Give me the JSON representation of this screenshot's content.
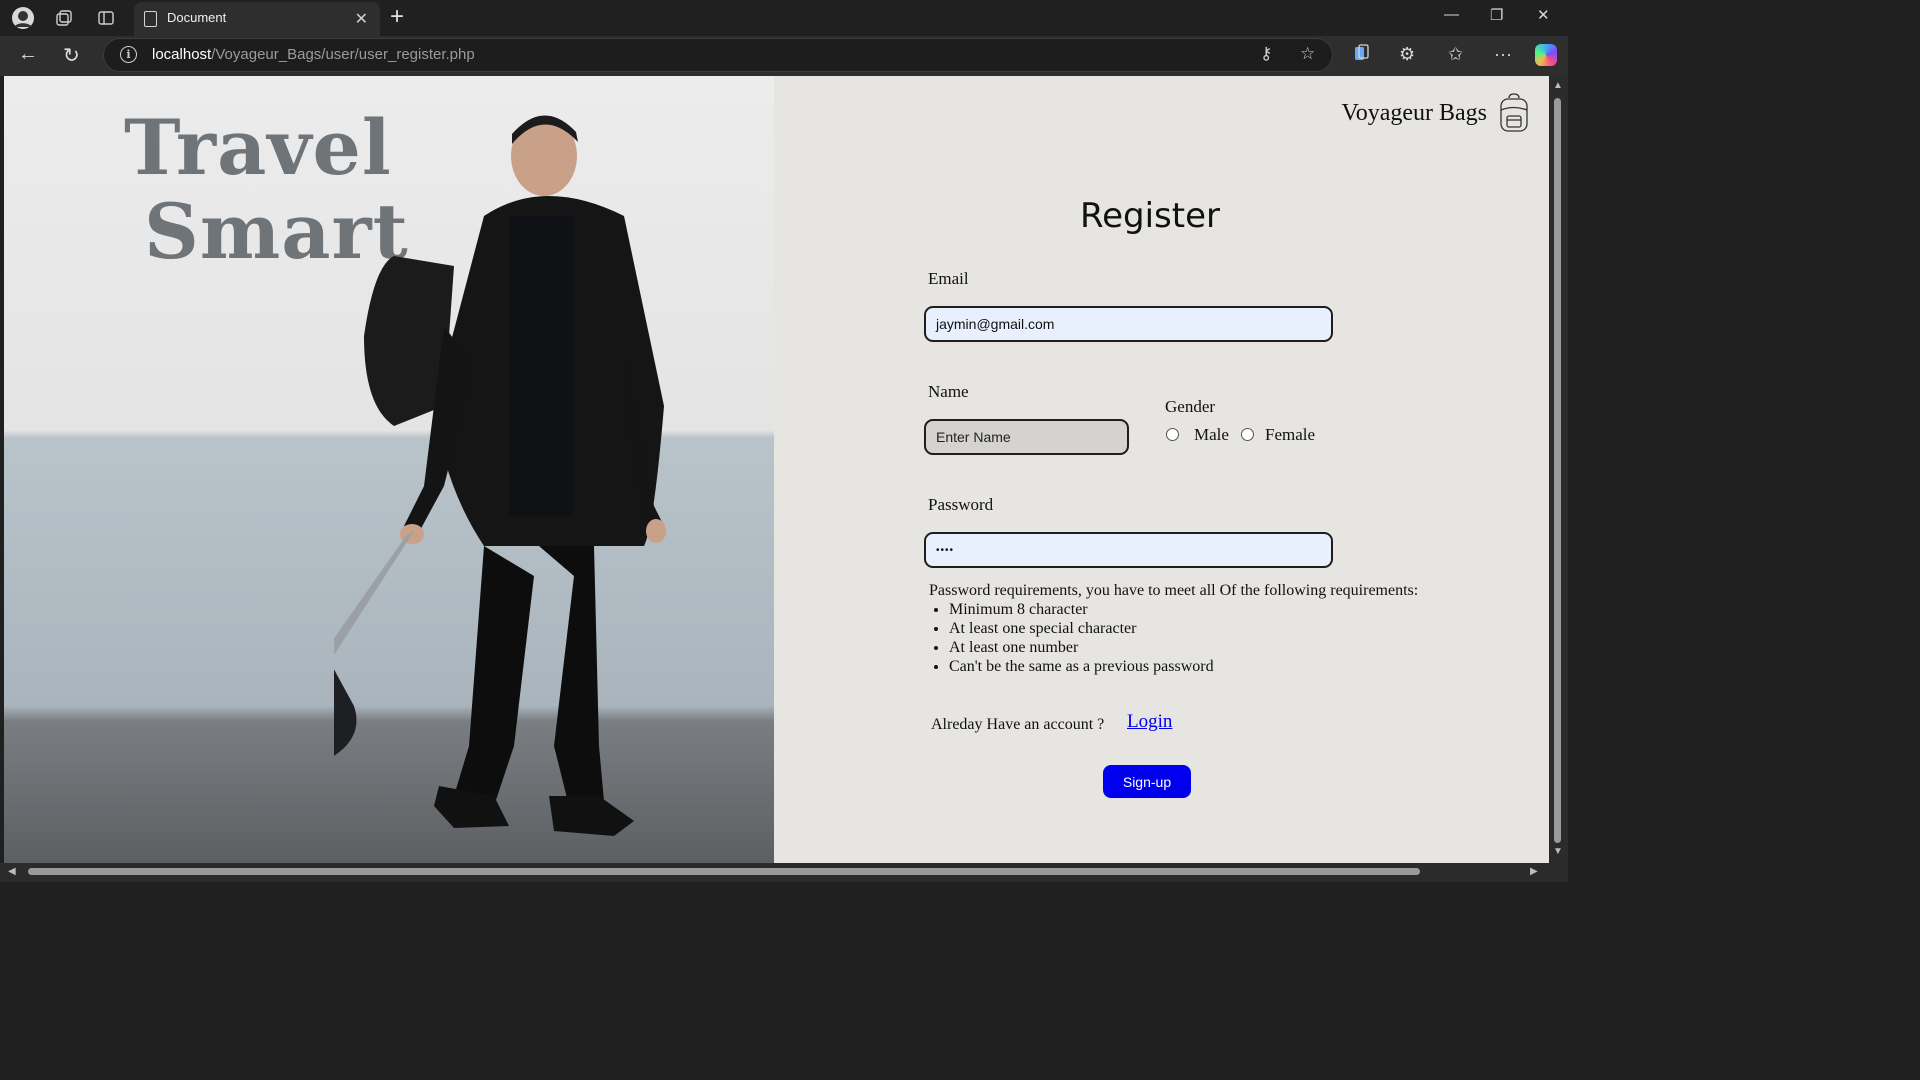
{
  "browser": {
    "tab_title": "Document",
    "url_host": "localhost",
    "url_path": "/Voyageur_Bags/user/user_register.php",
    "icons": [
      "profile-icon",
      "workspaces-icon",
      "vertical-tabs-icon",
      "document-icon",
      "close-icon",
      "new-tab-icon",
      "minimize-icon",
      "restore-icon",
      "window-close-icon",
      "back-icon",
      "refresh-icon",
      "site-info-icon",
      "password-key-icon",
      "favorite-star-icon",
      "collections-icon",
      "extensions-icon",
      "favorites-icon",
      "more-icon",
      "copilot-icon"
    ]
  },
  "hero": {
    "line1": "Travel",
    "line2": "Smart"
  },
  "brand": {
    "name": "Voyageur Bags",
    "logo_icon": "backpack-icon"
  },
  "form": {
    "title": "Register",
    "email_label": "Email",
    "email_value": "jaymin@gmail.com",
    "name_label": "Name",
    "name_placeholder": "Enter Name",
    "gender_label": "Gender",
    "gender_male": "Male",
    "gender_female": "Female",
    "password_label": "Password",
    "password_masked": "••••",
    "requirements_intro": "Password requirements, you have to meet all Of the following requirements:",
    "requirements": [
      "Minimum 8 character",
      "At least one special character",
      "At least one number",
      "Can't be the same as a previous password"
    ],
    "have_account": "Alreday Have an account ?",
    "login_link": "Login",
    "signup_button": "Sign-up"
  },
  "colors": {
    "accent_button": "#0000ee",
    "link": "#0000ee",
    "page_bg": "#e6e5e2",
    "input_autofill": "#e8f0fe"
  }
}
